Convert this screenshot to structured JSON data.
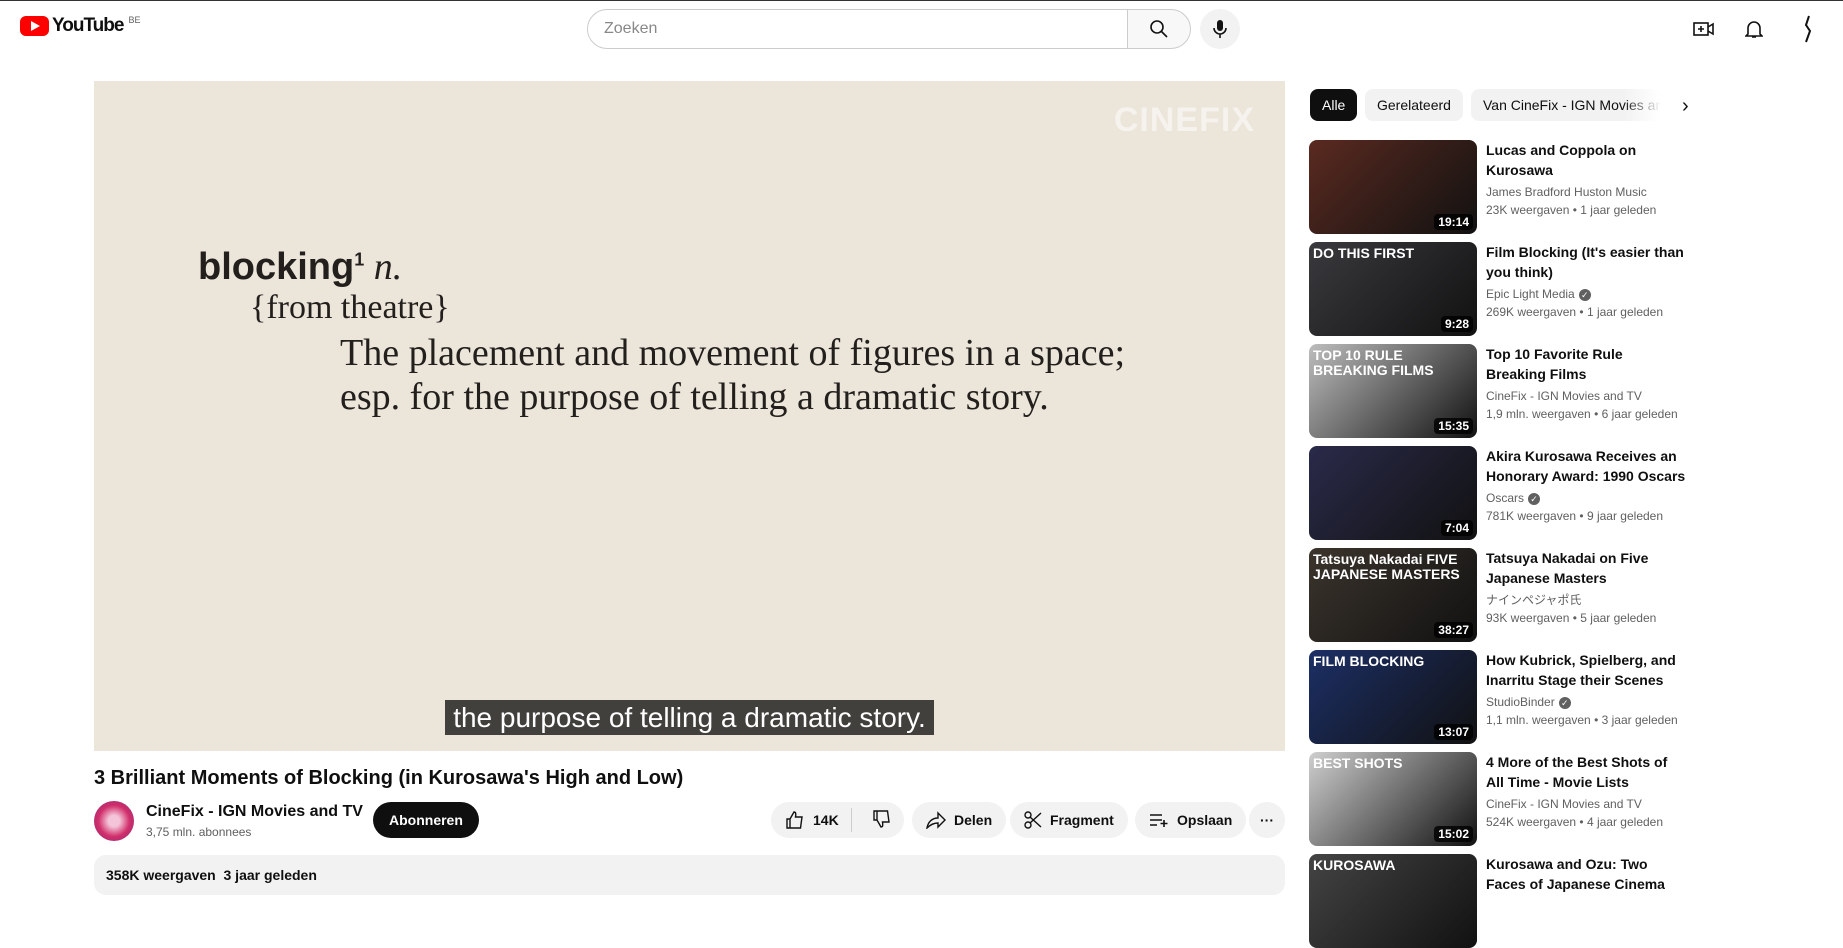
{
  "header": {
    "logo": "YouTube",
    "country": "BE",
    "search_placeholder": "Zoeken"
  },
  "video": {
    "watermark": "CINEFIX",
    "def_word": "blocking",
    "def_sup": "1",
    "def_pos": "n.",
    "def_origin": "{from theatre}",
    "def_line1": "The placement and movement of figures in a space;",
    "def_line2": "esp. for the purpose of telling a dramatic story.",
    "subtitle": "the purpose of telling a dramatic story.",
    "title": "3 Brilliant Moments of Blocking (in Kurosawa's High and Low)",
    "channel": "CineFix - IGN Movies and TV",
    "subscribers": "3,75 mln. abonnees",
    "subscribe": "Abonneren",
    "likes": "14K",
    "share": "Delen",
    "clip": "Fragment",
    "save": "Opslaan",
    "more": "···",
    "meta": "358K weergaven  3 jaar geleden"
  },
  "chips": [
    "Alle",
    "Gerelateerd",
    "Van CineFix - IGN Movies and TV"
  ],
  "recs": [
    {
      "title": "Lucas and Coppola on Kurosawa",
      "channel": "James Bradford Huston Music",
      "views": "23K weergaven",
      "age": "1 jaar geleden",
      "duration": "19:14",
      "label": "",
      "verified": false,
      "color": "#5a2a20"
    },
    {
      "title": "Film Blocking (It's easier than you think)",
      "channel": "Epic Light Media",
      "views": "269K weergaven",
      "age": "1 jaar geleden",
      "duration": "9:28",
      "label": "DO THIS FIRST",
      "verified": true,
      "color": "#3a3a3e"
    },
    {
      "title": "Top 10 Favorite Rule Breaking Films",
      "channel": "CineFix - IGN Movies and TV",
      "views": "1,9 mln. weergaven",
      "age": "6 jaar geleden",
      "duration": "15:35",
      "label": "TOP 10 RULE BREAKING FILMS",
      "verified": false,
      "color": "#bdbdbd"
    },
    {
      "title": "Akira Kurosawa Receives an Honorary Award: 1990 Oscars",
      "channel": "Oscars",
      "views": "781K weergaven",
      "age": "9 jaar geleden",
      "duration": "7:04",
      "label": "",
      "verified": true,
      "color": "#2a2a4a"
    },
    {
      "title": "Tatsuya Nakadai on Five Japanese Masters",
      "channel": "ナインペジャポ氏",
      "views": "93K weergaven",
      "age": "5 jaar geleden",
      "duration": "38:27",
      "label": "Tatsuya Nakadai FIVE JAPANESE MASTERS",
      "verified": false,
      "color": "#3b342c"
    },
    {
      "title": "How Kubrick, Spielberg, and Inarritu Stage their Scenes",
      "channel": "StudioBinder",
      "views": "1,1 mln. weergaven",
      "age": "3 jaar geleden",
      "duration": "13:07",
      "label": "FILM BLOCKING",
      "verified": true,
      "color": "#1c2f66"
    },
    {
      "title": "4 More of the Best Shots of All Time - Movie Lists",
      "channel": "CineFix - IGN Movies and TV",
      "views": "524K weergaven",
      "age": "4 jaar geleden",
      "duration": "15:02",
      "label": "BEST SHOTS",
      "verified": false,
      "color": "#cfcfcf"
    },
    {
      "title": "Kurosawa and Ozu: Two Faces of Japanese Cinema",
      "channel": "",
      "views": "",
      "age": "",
      "duration": "",
      "label": "KUROSAWA",
      "verified": false,
      "color": "#444"
    }
  ]
}
